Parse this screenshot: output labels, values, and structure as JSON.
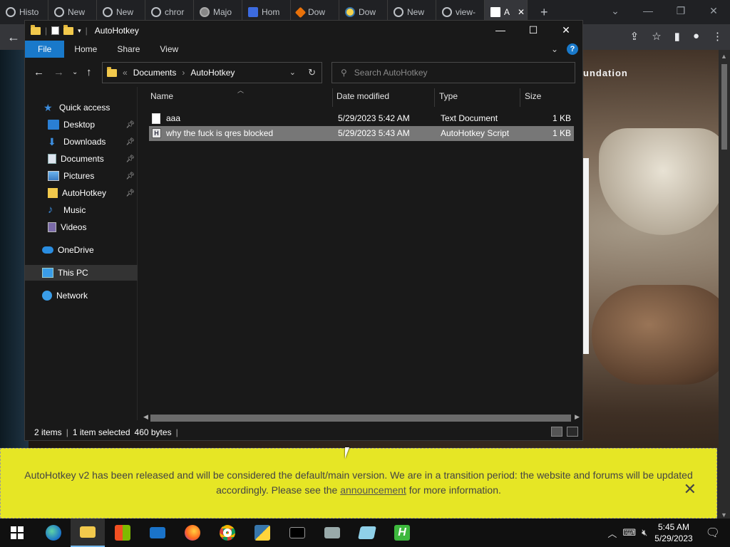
{
  "browser": {
    "tabs": [
      {
        "label": "Histo",
        "icon": "history-icon"
      },
      {
        "label": "New",
        "icon": "chrome-icon"
      },
      {
        "label": "New",
        "icon": "chrome-icon"
      },
      {
        "label": "chror",
        "icon": "chrome-icon"
      },
      {
        "label": "Majo",
        "icon": "picture-icon"
      },
      {
        "label": "Hom",
        "icon": "site-icon"
      },
      {
        "label": "Dow",
        "icon": "download-site-icon"
      },
      {
        "label": "Dow",
        "icon": "python-icon"
      },
      {
        "label": "New",
        "icon": "chrome-icon"
      },
      {
        "label": "view-",
        "icon": "chrome-icon"
      },
      {
        "label": "A",
        "icon": "autohotkey-icon"
      }
    ],
    "new_tab": "+",
    "page_heading": "undation",
    "banner": {
      "text_before": "AutoHotkey v2 has been released and will be considered the default/main version. We are in a transition period: the website and forums will be updated accordingly. Please see the",
      "link": "announcement",
      "text_after": "for more information.",
      "close": "✕"
    }
  },
  "explorer": {
    "title": "AutoHotkey",
    "ribbon": [
      "File",
      "Home",
      "Share",
      "View"
    ],
    "breadcrumb": {
      "prefix": "«",
      "parts": [
        "Documents",
        "AutoHotkey"
      ]
    },
    "search_placeholder": "Search AutoHotkey",
    "sidebar": [
      {
        "label": "Quick access",
        "icon": "star-icon",
        "pinned": false
      },
      {
        "label": "Desktop",
        "icon": "desktop-icon",
        "pinned": true
      },
      {
        "label": "Downloads",
        "icon": "downloads-icon",
        "pinned": true
      },
      {
        "label": "Documents",
        "icon": "documents-icon",
        "pinned": true
      },
      {
        "label": "Pictures",
        "icon": "pictures-icon",
        "pinned": true
      },
      {
        "label": "AutoHotkey",
        "icon": "folder-icon",
        "pinned": true
      },
      {
        "label": "Music",
        "icon": "music-icon",
        "pinned": false
      },
      {
        "label": "Videos",
        "icon": "videos-icon",
        "pinned": false
      },
      {
        "label": "OneDrive",
        "icon": "onedrive-icon",
        "pinned": false
      },
      {
        "label": "This PC",
        "icon": "this-pc-icon",
        "pinned": false
      },
      {
        "label": "Network",
        "icon": "network-icon",
        "pinned": false
      }
    ],
    "columns": [
      "Name",
      "Date modified",
      "Type",
      "Size"
    ],
    "files": [
      {
        "name": "aaa",
        "date": "5/29/2023 5:42 AM",
        "type": "Text Document",
        "size": "1 KB",
        "selected": false
      },
      {
        "name": "why the fuck is qres blocked",
        "date": "5/29/2023 5:43 AM",
        "type": "AutoHotkey Script",
        "size": "1 KB",
        "selected": true
      }
    ],
    "status": {
      "count": "2 items",
      "selection": "1 item selected",
      "size": "460 bytes"
    }
  },
  "taskbar": {
    "apps": [
      "start",
      "edge",
      "file-explorer",
      "store",
      "mail",
      "firefox",
      "chrome",
      "python",
      "terminal",
      "system",
      "notepad",
      "hotkey"
    ],
    "time": "5:45 AM",
    "date": "5/29/2023"
  },
  "colors": {
    "accent": "#1979ca",
    "banner": "#e6e625",
    "selection": "#777777"
  }
}
